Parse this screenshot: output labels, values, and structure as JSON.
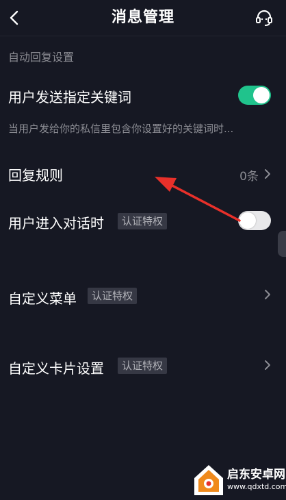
{
  "header": {
    "title": "消息管理",
    "back_icon": "chevron-left-icon",
    "support_icon": "headset-icon"
  },
  "auto_reply": {
    "section_title": "自动回复设置",
    "keyword": {
      "label": "用户发送指定关键词",
      "toggle_on": true,
      "description": "当用户发给你的私信里包含你设置好的关键词时..."
    },
    "reply_rules": {
      "label": "回复规则",
      "count": "0条"
    },
    "enter_chat": {
      "label": "用户进入对话时",
      "badge": "认证特权",
      "toggle_on": false
    }
  },
  "custom_menu": {
    "label": "自定义菜单",
    "badge": "认证特权"
  },
  "custom_card": {
    "label": "自定义卡片设置",
    "badge": "认证特权"
  },
  "annotation": {
    "color": "#e8302a",
    "points_to": "reply_rules"
  },
  "watermark": {
    "title": "启东安卓网",
    "url": "www.qdxtd.com"
  },
  "colors": {
    "background": "#161823",
    "toggle_on": "#20c38c",
    "secondary_text": "#8b8c93",
    "badge_bg": "#363844"
  }
}
